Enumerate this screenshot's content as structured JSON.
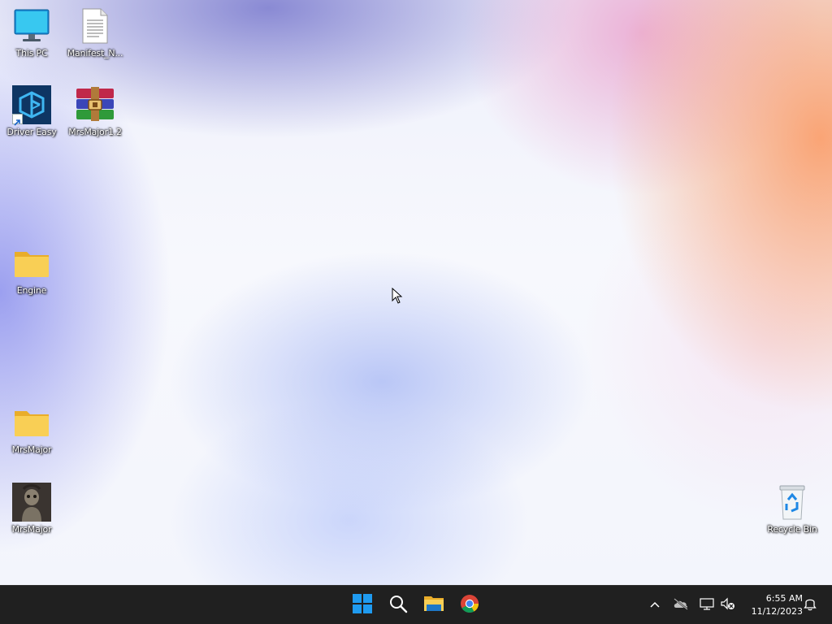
{
  "desktop": {
    "icons": [
      {
        "label": "This PC",
        "icon": "monitor-icon"
      },
      {
        "label": "Manifest_N...",
        "icon": "text-document-icon"
      },
      {
        "label": "Driver Easy",
        "icon": "driver-easy-app-icon"
      },
      {
        "label": "MrsMajor1.2",
        "icon": "winrar-archive-icon"
      },
      {
        "label": "Engine",
        "icon": "folder-icon"
      },
      {
        "label": "MrsMajor",
        "icon": "folder-icon"
      },
      {
        "label": "MrsMajor",
        "icon": "image-thumbnail-icon"
      },
      {
        "label": "Recycle Bin",
        "icon": "recycle-bin-icon"
      }
    ]
  },
  "taskbar": {
    "pinned": [
      {
        "name": "Start",
        "icon": "windows-start-icon"
      },
      {
        "name": "Search",
        "icon": "search-icon"
      },
      {
        "name": "File Explorer",
        "icon": "file-explorer-icon"
      },
      {
        "name": "Google Chrome",
        "icon": "chrome-icon"
      }
    ],
    "tray": [
      "chevron-up-icon",
      "onedrive-offline-icon",
      "network-icon",
      "volume-muted-icon",
      "notification-bell-icon"
    ],
    "clock": {
      "time": "6:55 AM",
      "date": "11/12/2023"
    }
  },
  "colors": {
    "taskbar_bg": "#202020",
    "folder_yellow": "#f7c83e",
    "start_blue": "#1f9bf0"
  }
}
